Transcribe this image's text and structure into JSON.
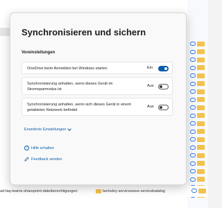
{
  "dialog": {
    "title": "Synchronisieren und sichern",
    "section": "Voreinstellungen",
    "settings": [
      {
        "label": "OneDrive beim Anmelden bei Windows starten",
        "state": "Ein",
        "on": true
      },
      {
        "label_line1": "Synchronisierung anhalten, wenn dieses Gerät im",
        "label_line2": "Stromsparmodus ist",
        "state": "Aus",
        "on": false
      },
      {
        "label_line1": "Synchronisierung anhalten, wenn sich dieses Gerät in einem",
        "label_line2": "getakteten Netzwerk befindet",
        "state": "Aus",
        "on": false
      }
    ],
    "advanced_link": "Erweiterte Einstellungen",
    "help_link": "Hilfe erhalten",
    "feedback_link": "Feedback senden"
  },
  "background": {
    "file1": "ad-faq-teams-sharepoint-dateiberechtigungen",
    "file2": "berkeley-servicewave-servicekatalog"
  },
  "colors": {
    "accent": "#0b5cad",
    "folder": "#f2c14e"
  },
  "icons": [
    "cloud-icon",
    "folder-icon",
    "help-icon",
    "feedback-icon",
    "chevron-down-icon"
  ]
}
